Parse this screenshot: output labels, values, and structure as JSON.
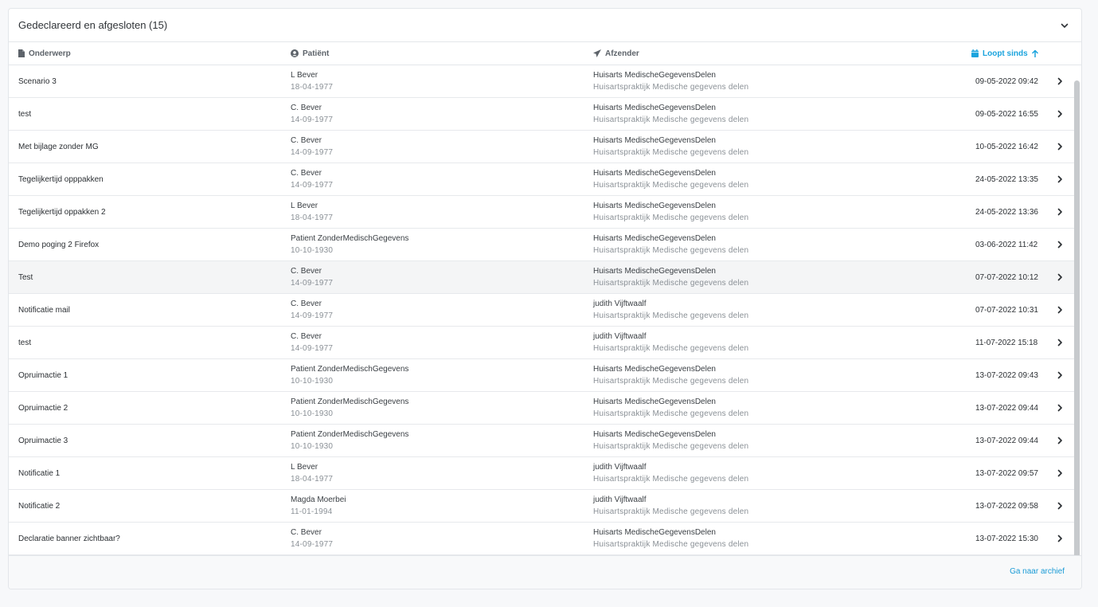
{
  "panel": {
    "title": "Gedeclareerd en afgesloten (15)",
    "collapse_icon": "chevron-down-icon"
  },
  "columns": {
    "subject": {
      "label": "Onderwerp",
      "icon": "file-icon"
    },
    "patient": {
      "label": "Patiënt",
      "icon": "user-circle-icon"
    },
    "sender": {
      "label": "Afzender",
      "icon": "paper-plane-icon"
    },
    "date": {
      "label": "Loopt sinds",
      "icon": "calendar-icon",
      "sort_icon": "arrow-up-icon",
      "sorted": true
    }
  },
  "rows": [
    {
      "subject": "Scenario 3",
      "patient_name": "L Bever",
      "patient_dob": "18-04-1977",
      "sender_name": "Huisarts MedischeGegevensDelen",
      "sender_org": "Huisartspraktijk Medische gegevens delen",
      "date": "09-05-2022 09:42"
    },
    {
      "subject": "test",
      "patient_name": "C. Bever",
      "patient_dob": "14-09-1977",
      "sender_name": "Huisarts MedischeGegevensDelen",
      "sender_org": "Huisartspraktijk Medische gegevens delen",
      "date": "09-05-2022 16:55"
    },
    {
      "subject": "Met bijlage zonder MG",
      "patient_name": "C. Bever",
      "patient_dob": "14-09-1977",
      "sender_name": "Huisarts MedischeGegevensDelen",
      "sender_org": "Huisartspraktijk Medische gegevens delen",
      "date": "10-05-2022 16:42"
    },
    {
      "subject": "Tegelijkertijd opppakken",
      "patient_name": "C. Bever",
      "patient_dob": "14-09-1977",
      "sender_name": "Huisarts MedischeGegevensDelen",
      "sender_org": "Huisartspraktijk Medische gegevens delen",
      "date": "24-05-2022 13:35"
    },
    {
      "subject": "Tegelijkertijd oppakken 2",
      "patient_name": "L Bever",
      "patient_dob": "18-04-1977",
      "sender_name": "Huisarts MedischeGegevensDelen",
      "sender_org": "Huisartspraktijk Medische gegevens delen",
      "date": "24-05-2022 13:36"
    },
    {
      "subject": "Demo poging 2 Firefox",
      "patient_name": "Patient ZonderMedischGegevens",
      "patient_dob": "10-10-1930",
      "sender_name": "Huisarts MedischeGegevensDelen",
      "sender_org": "Huisartspraktijk Medische gegevens delen",
      "date": "03-06-2022 11:42"
    },
    {
      "subject": "Test",
      "patient_name": "C. Bever",
      "patient_dob": "14-09-1977",
      "sender_name": "Huisarts MedischeGegevensDelen",
      "sender_org": "Huisartspraktijk Medische gegevens delen",
      "date": "07-07-2022 10:12",
      "hovered": true
    },
    {
      "subject": "Notificatie mail",
      "patient_name": "C. Bever",
      "patient_dob": "14-09-1977",
      "sender_name": "judith Vijftwaalf",
      "sender_org": "Huisartspraktijk Medische gegevens delen",
      "date": "07-07-2022 10:31"
    },
    {
      "subject": "test",
      "patient_name": "C. Bever",
      "patient_dob": "14-09-1977",
      "sender_name": "judith Vijftwaalf",
      "sender_org": "Huisartspraktijk Medische gegevens delen",
      "date": "11-07-2022 15:18"
    },
    {
      "subject": "Opruimactie 1",
      "patient_name": "Patient ZonderMedischGegevens",
      "patient_dob": "10-10-1930",
      "sender_name": "Huisarts MedischeGegevensDelen",
      "sender_org": "Huisartspraktijk Medische gegevens delen",
      "date": "13-07-2022 09:43"
    },
    {
      "subject": "Opruimactie 2",
      "patient_name": "Patient ZonderMedischGegevens",
      "patient_dob": "10-10-1930",
      "sender_name": "Huisarts MedischeGegevensDelen",
      "sender_org": "Huisartspraktijk Medische gegevens delen",
      "date": "13-07-2022 09:44"
    },
    {
      "subject": "Opruimactie 3",
      "patient_name": "Patient ZonderMedischGegevens",
      "patient_dob": "10-10-1930",
      "sender_name": "Huisarts MedischeGegevensDelen",
      "sender_org": "Huisartspraktijk Medische gegevens delen",
      "date": "13-07-2022 09:44"
    },
    {
      "subject": "Notificatie 1",
      "patient_name": "L Bever",
      "patient_dob": "18-04-1977",
      "sender_name": "judith Vijftwaalf",
      "sender_org": "Huisartspraktijk Medische gegevens delen",
      "date": "13-07-2022 09:57"
    },
    {
      "subject": "Notificatie 2",
      "patient_name": "Magda Moerbei",
      "patient_dob": "11-01-1994",
      "sender_name": "judith Vijftwaalf",
      "sender_org": "Huisartspraktijk Medische gegevens delen",
      "date": "13-07-2022 09:58"
    },
    {
      "subject": "Declaratie banner zichtbaar?",
      "patient_name": "C. Bever",
      "patient_dob": "14-09-1977",
      "sender_name": "Huisarts MedischeGegevensDelen",
      "sender_org": "Huisartspraktijk Medische gegevens delen",
      "date": "13-07-2022 15:30"
    }
  ],
  "row_chevron_icon": "chevron-right-icon",
  "footer": {
    "archive_link": "Ga naar archief"
  },
  "colors": {
    "accent": "#1aa3dd",
    "border": "#e3e6ea",
    "muted_text": "#8a9096",
    "hover_row": "#f4f5f6"
  }
}
